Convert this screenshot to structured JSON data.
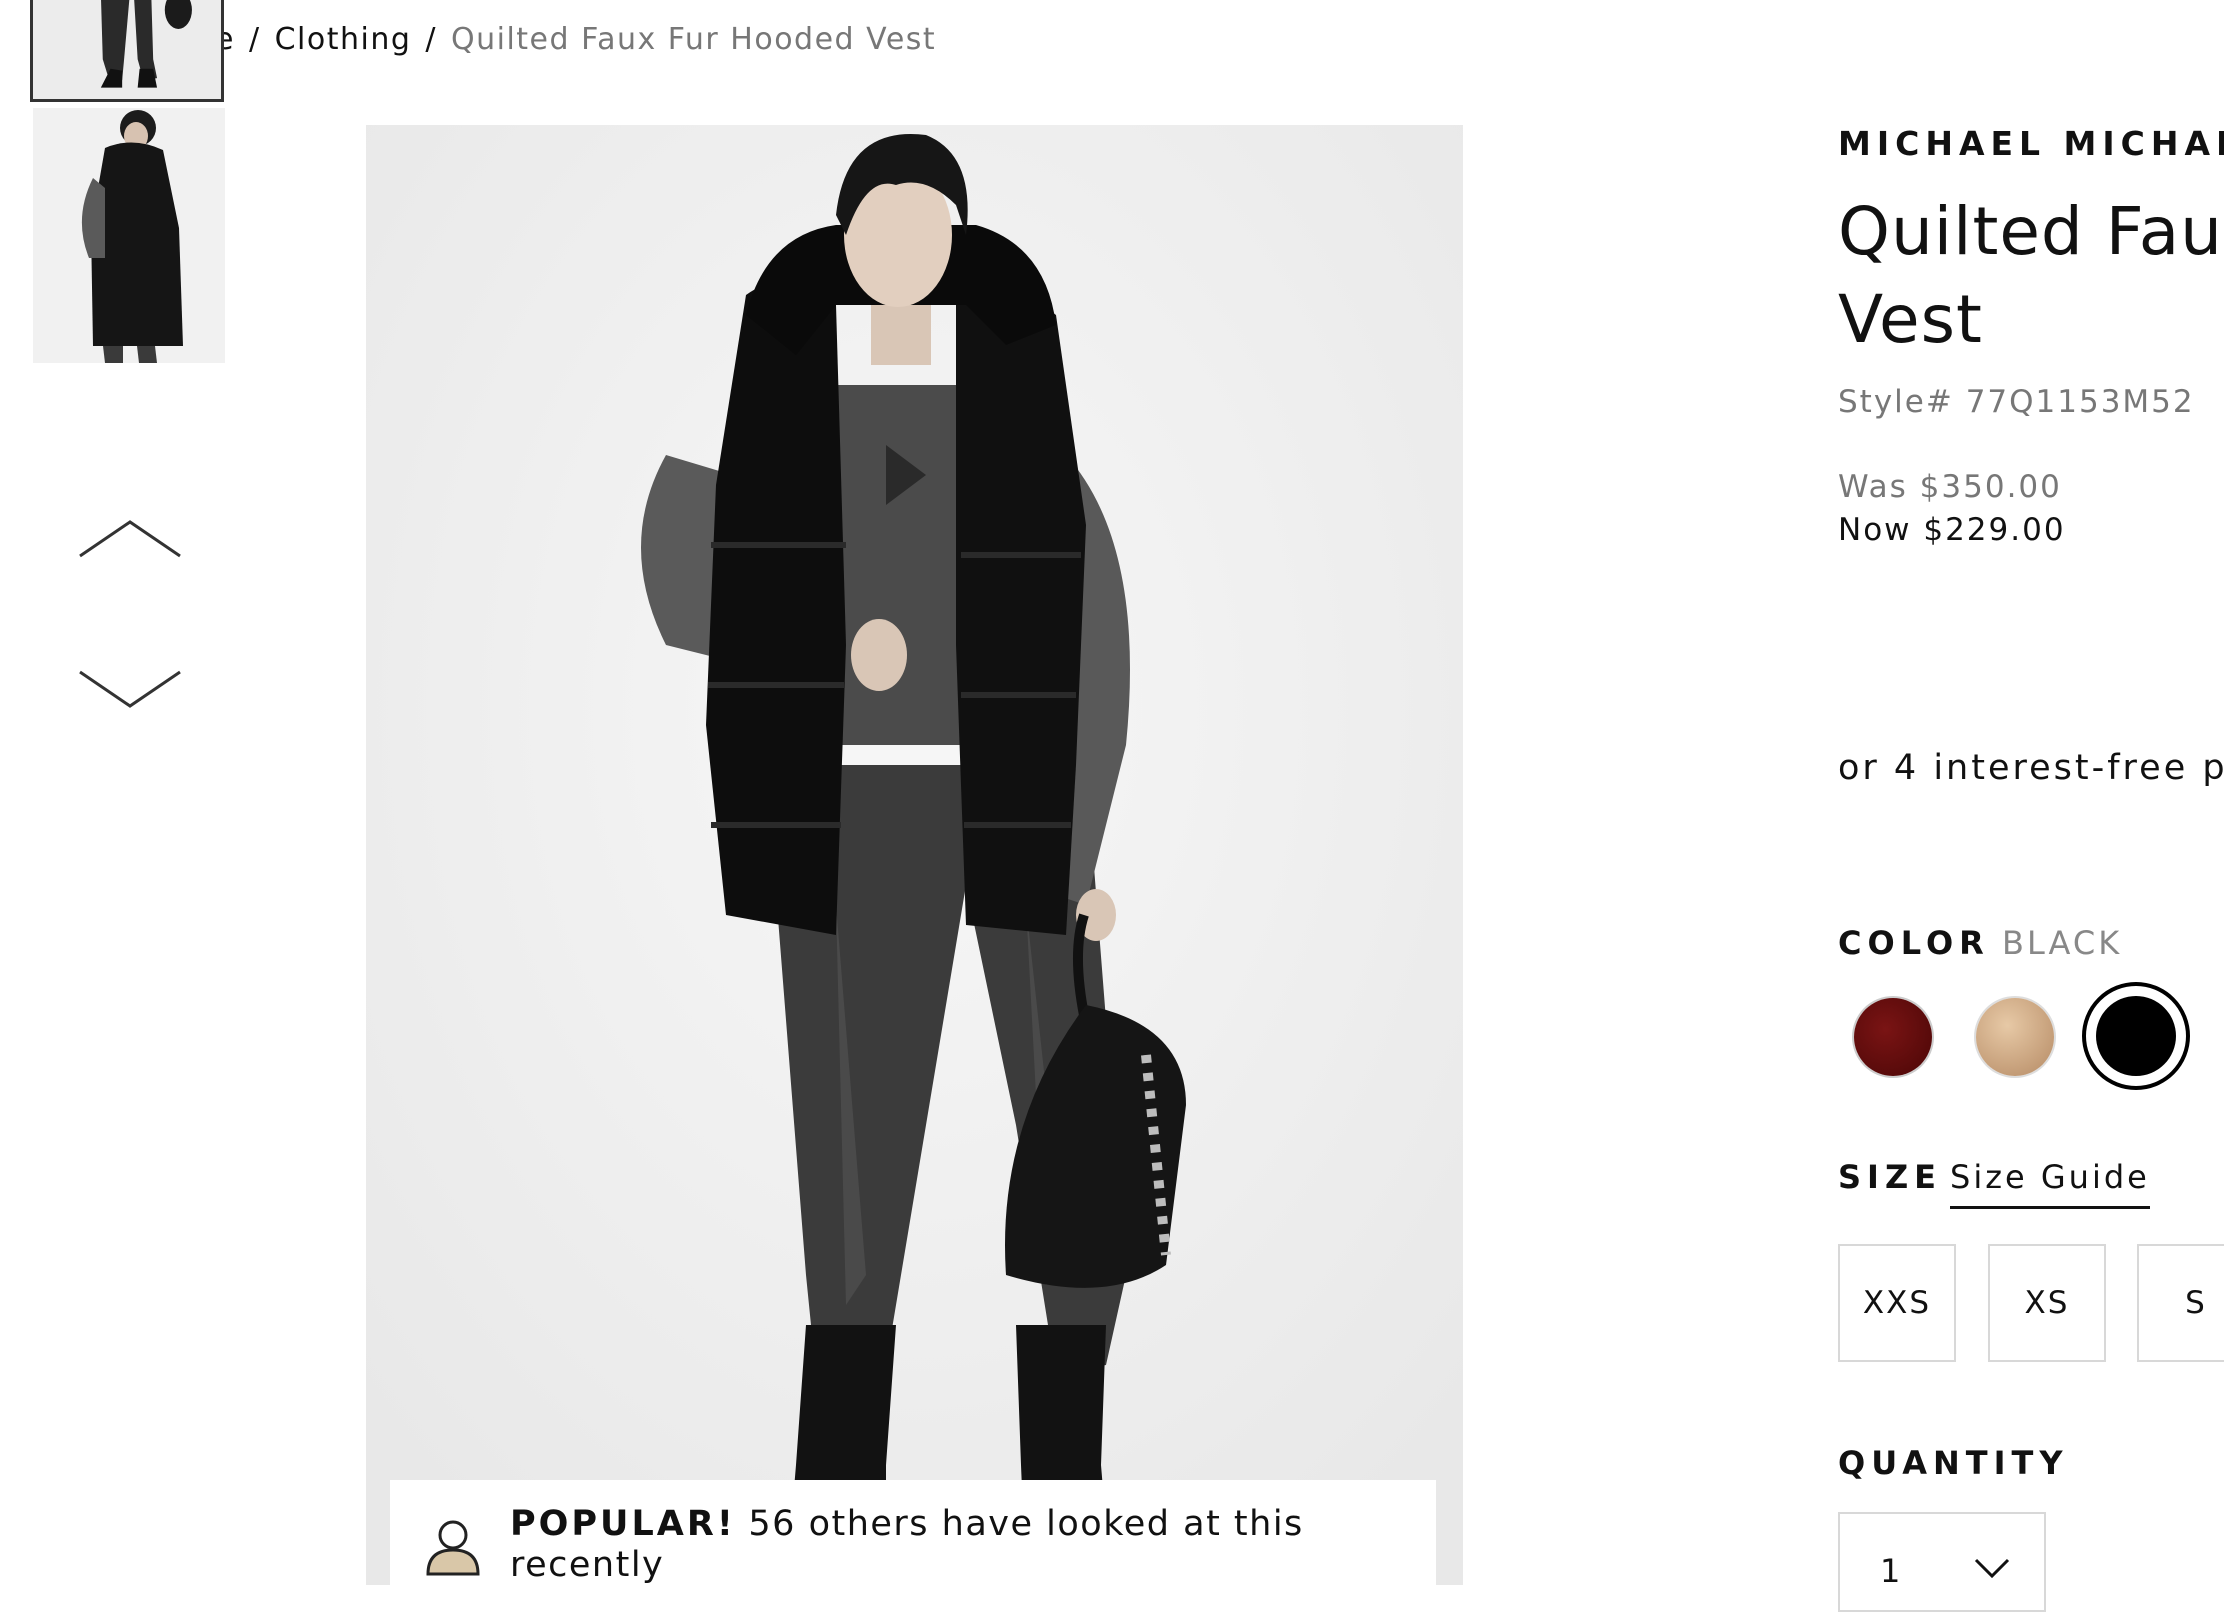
{
  "breadcrumb": {
    "items": [
      "e",
      "Clothing"
    ],
    "separator": "/",
    "current": "Quilted Faux Fur Hooded Vest"
  },
  "gallery": {
    "nav_up_icon": "chevron-up-icon",
    "nav_down_icon": "chevron-down-icon"
  },
  "popular": {
    "badge": "POPULAR!",
    "message": " 56 others have looked at this recently",
    "icon": "user-icon"
  },
  "product": {
    "brand": "MICHAEL MICHAEL",
    "title_line1": "Quilted Fau",
    "title_line2": "Vest",
    "style": "Style# 77Q1153M52",
    "was_price": "Was $350.00",
    "now_price": "Now $229.00",
    "installments": "or 4 interest-free p"
  },
  "color": {
    "label": "COLOR",
    "selected": "BLACK",
    "swatches": [
      {
        "name": "red",
        "hex": "#5c0b0b"
      },
      {
        "name": "tan",
        "hex": "#d2ad86"
      },
      {
        "name": "black",
        "hex": "#000000",
        "selected": true
      }
    ]
  },
  "size": {
    "label": "SIZE",
    "guide": "Size Guide",
    "options": [
      "XXS",
      "XS",
      "S"
    ]
  },
  "quantity": {
    "label": "QUANTITY",
    "value": "1"
  }
}
